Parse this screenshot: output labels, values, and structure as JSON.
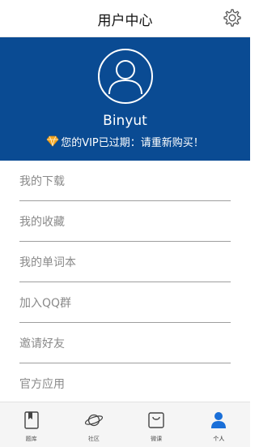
{
  "header": {
    "title": "用户中心"
  },
  "profile": {
    "username": "Binyut",
    "vip_status": "您的VIP已过期：请重新购买！"
  },
  "menu": {
    "items": [
      {
        "label": "我的下载"
      },
      {
        "label": "我的收藏"
      },
      {
        "label": "我的单词本"
      },
      {
        "label": "加入QQ群"
      },
      {
        "label": "邀请好友"
      },
      {
        "label": "官方应用"
      }
    ]
  },
  "tabbar": {
    "tabs": [
      {
        "label": "题库",
        "icon": "book-icon"
      },
      {
        "label": "社区",
        "icon": "planet-icon"
      },
      {
        "label": "微课",
        "icon": "bag-icon"
      },
      {
        "label": "个人",
        "icon": "person-icon",
        "active": true
      }
    ]
  },
  "colors": {
    "brand": "#0a4b93",
    "active_tab": "#1a6fd8",
    "vip_diamond": "#f5a623"
  }
}
